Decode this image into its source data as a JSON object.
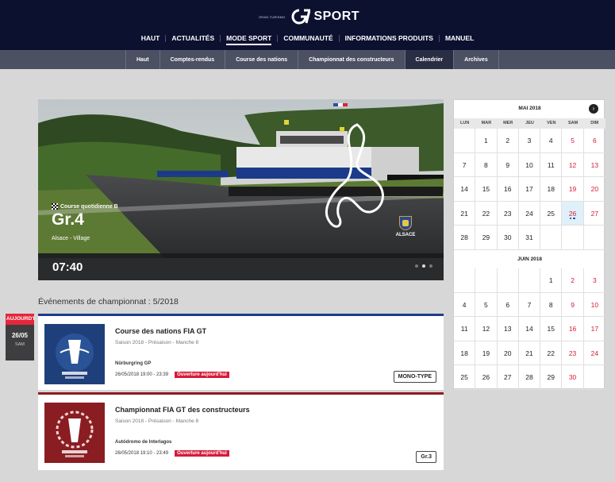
{
  "brand": {
    "small_text": "GRAN TURISMO",
    "name": "SPORT"
  },
  "main_nav": [
    {
      "label": "HAUT",
      "active": false
    },
    {
      "label": "ACTUALITÉS",
      "active": false
    },
    {
      "label": "MODE SPORT",
      "active": true
    },
    {
      "label": "COMMUNAUTÉ",
      "active": false
    },
    {
      "label": "INFORMATIONS PRODUITS",
      "active": false
    },
    {
      "label": "MANUEL",
      "active": false
    }
  ],
  "sub_nav": [
    {
      "label": "Haut",
      "active": false
    },
    {
      "label": "Comptes-rendus",
      "active": false
    },
    {
      "label": "Course des nations",
      "active": false
    },
    {
      "label": "Championnat des constructeurs",
      "active": false
    },
    {
      "label": "Calendrier",
      "active": true
    },
    {
      "label": "Archives",
      "active": false
    }
  ],
  "hero": {
    "race_type": "Course quotidienne B",
    "grade": "Gr.4",
    "location": "Alsace - Village",
    "time": "07:40",
    "logo_text": "ALSACE",
    "carousel_total": 3,
    "carousel_active": 2
  },
  "events_heading": "Événements de championnat : 5/2018",
  "today_marker": {
    "label": "AUJOURD'HUI",
    "date": "26/05",
    "day": "SAM"
  },
  "events": [
    {
      "title": "Course des nations FIA GT",
      "subtitle": "Saison 2018 - Présaison - Manche 8",
      "track": "Nürburgring GP",
      "schedule": "26/05/2018 19:00 - 23:39",
      "badge": "Ouverture aujourd'hui",
      "category": "MONO-TYPE",
      "accent": "#1f3b8f"
    },
    {
      "title": "Championnat FIA GT des constructeurs",
      "subtitle": "Saison 2018 - Présaison - Manche 8",
      "track": "Autódromo de Interlagos",
      "schedule": "26/05/2018 19:10 - 23:49",
      "badge": "Ouverture aujourd'hui",
      "category": "Gr.3",
      "accent": "#8f1b22"
    }
  ],
  "calendar": {
    "weekdays": [
      "LUN",
      "MAR",
      "MER",
      "JEU",
      "VEN",
      "SAM",
      "DIM"
    ],
    "months": [
      {
        "title": "MAI 2018",
        "cells": [
          "",
          "1",
          "2",
          "3",
          "4",
          "5",
          "6",
          "7",
          "8",
          "9",
          "10",
          "11",
          "12",
          "13",
          "14",
          "15",
          "16",
          "17",
          "18",
          "19",
          "20",
          "21",
          "22",
          "23",
          "24",
          "25",
          "26",
          "27",
          "28",
          "29",
          "30",
          "31",
          "",
          "",
          ""
        ],
        "selected": "26",
        "event_days": [
          "26"
        ]
      },
      {
        "title": "JUIN 2018",
        "cells": [
          "",
          "",
          "",
          "",
          "1",
          "2",
          "3",
          "4",
          "5",
          "6",
          "7",
          "8",
          "9",
          "10",
          "11",
          "12",
          "13",
          "14",
          "15",
          "16",
          "17",
          "18",
          "19",
          "20",
          "21",
          "22",
          "23",
          "24",
          "25",
          "26",
          "27",
          "28",
          "29",
          "30",
          ""
        ],
        "selected": "",
        "event_days": []
      }
    ]
  },
  "colors": {
    "header_bg": "#0d1130",
    "subnav_bg": "#4b5063",
    "accent_red": "#d61b3b",
    "accent_blue": "#1f3b8f"
  }
}
